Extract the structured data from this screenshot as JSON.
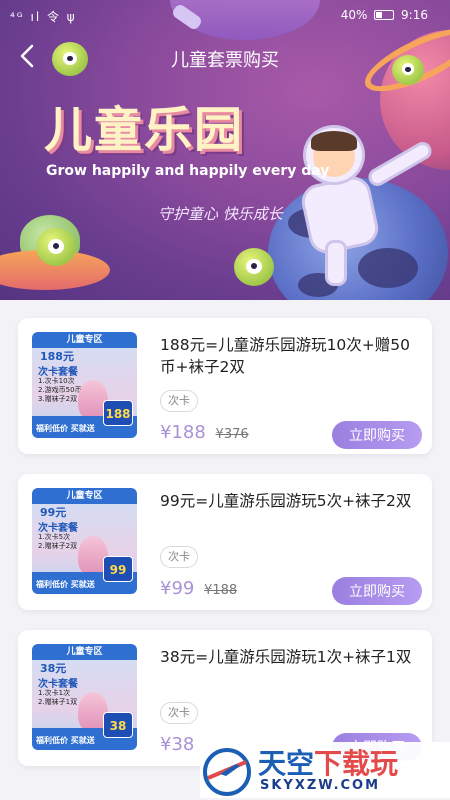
{
  "status_bar": {
    "left": "⁴ᴳ ıl 令 ψ",
    "battery_percent": "40%",
    "time": "9:16"
  },
  "nav": {
    "back_icon": "chevron-left-icon",
    "title": "儿童套票购买"
  },
  "banner": {
    "title": "儿童乐园",
    "subtitle": "Grow happily and happily every day",
    "slogan": "守护童心 快乐成长"
  },
  "products": [
    {
      "title": "188元=儿童游乐园游玩10次+赠50币+袜子2双",
      "tag": "次卡",
      "price": "¥188",
      "original_price": "¥376",
      "buy_label": "立即购买",
      "thumb": {
        "header": "儿童专区",
        "price_text": "188元",
        "sub": "次卡套餐",
        "lines": [
          "1.次卡10次",
          "2.游戏币50币",
          "3.赠袜子2双"
        ],
        "footer": "福利低价  买就送",
        "badge": "188"
      }
    },
    {
      "title": "99元=儿童游乐园游玩5次+袜子2双",
      "tag": "次卡",
      "price": "¥99",
      "original_price": "¥188",
      "buy_label": "立即购买",
      "thumb": {
        "header": "儿童专区",
        "price_text": "99元",
        "sub": "次卡套餐",
        "lines": [
          "1.次卡5次",
          "2.赠袜子2双"
        ],
        "footer": "福利低价  买就送",
        "badge": "99"
      }
    },
    {
      "title": "38元=儿童游乐园游玩1次+袜子1双",
      "tag": "次卡",
      "price": "¥38",
      "original_price": "",
      "buy_label": "立即购买",
      "thumb": {
        "header": "儿童专区",
        "price_text": "38元",
        "sub": "次卡套餐",
        "lines": [
          "1.次卡1次",
          "2.赠袜子1双"
        ],
        "footer": "福利低价  买就送",
        "badge": "38"
      }
    }
  ],
  "watermark": {
    "cn_blue": "天空",
    "cn_red": "下载玩",
    "en": "SKYXZW.COM"
  }
}
